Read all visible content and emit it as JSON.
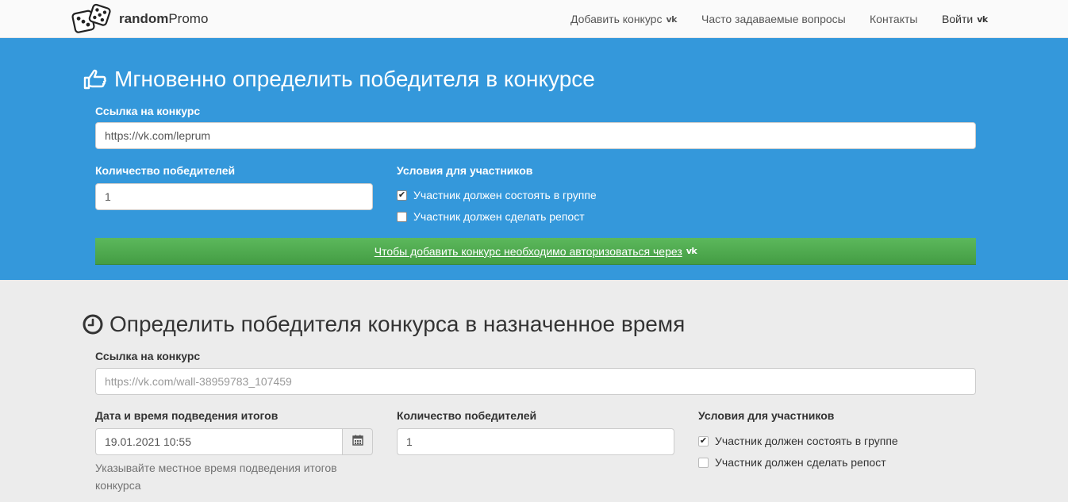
{
  "brand": {
    "bold": "random",
    "regular": "Promo"
  },
  "nav": {
    "add_contest": "Добавить конкурс",
    "faq": "Часто задаваемые вопросы",
    "contacts": "Контакты",
    "login": "Войти",
    "vk_icon_text": "vk"
  },
  "instant": {
    "title": "Мгновенно определить победителя в конкурсе",
    "link_label": "Ссылка на конкурс",
    "link_value": "https://vk.com/leprum",
    "winners_label": "Количество победителей",
    "winners_value": "1",
    "conditions_label": "Условия для участников",
    "cond_group": "Участник должен состоять в группе",
    "cond_group_checked": true,
    "cond_repost": "Участник должен сделать репост",
    "cond_repost_checked": false,
    "auth_text": "Чтобы добавить конкурс необходимо авторизоваться через"
  },
  "scheduled": {
    "title": "Определить победителя конкурса в назначенное время",
    "link_label": "Ссылка на конкурс",
    "link_placeholder": "https://vk.com/wall-38959783_107459",
    "datetime_label": "Дата и время подведения итогов",
    "datetime_value": "19.01.2021 10:55",
    "datetime_help": "Указывайте местное время подведения итогов конкурса",
    "winners_label": "Количество победителей",
    "winners_value": "1",
    "conditions_label": "Условия для участников",
    "cond_group": "Участник должен состоять в группе",
    "cond_group_checked": true,
    "cond_repost": "Участник должен сделать репост",
    "cond_repost_checked": false
  },
  "colors": {
    "primary": "#3498db",
    "success": "#5cb85c",
    "page_bg": "#ececec"
  },
  "icons": [
    "dice-logo-icon",
    "vk-icon",
    "thumbs-up-icon",
    "clock-icon",
    "calendar-icon",
    "checkmark-icon"
  ]
}
